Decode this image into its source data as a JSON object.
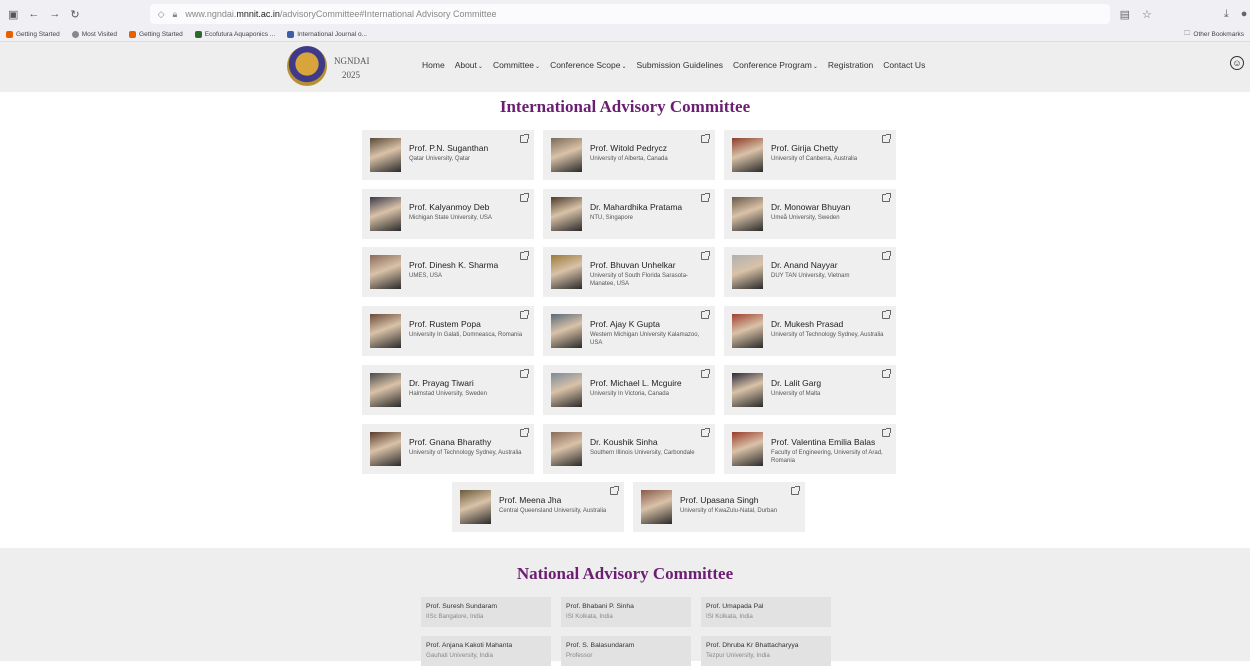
{
  "browser": {
    "url_prefix": "www.ngndai.",
    "url_domain": "mnnit.ac.in",
    "url_suffix": "/advisoryCommittee#International Advisory Committee",
    "bookmarks": [
      "Getting Started",
      "Most Visited",
      "Getting Started",
      "Ecofutura Aquaponics ...",
      "International Journal o..."
    ],
    "other_bookmarks": "Other Bookmarks"
  },
  "site": {
    "brand": "NGNDAI",
    "year": "2025",
    "menu": [
      "Home",
      "About",
      "Committee",
      "Conference Scope",
      "Submission Guidelines",
      "Conference Program",
      "Registration",
      "Contact Us"
    ]
  },
  "international": {
    "title": "International Advisory Committee",
    "members": [
      {
        "name": "Prof. P.N. Suganthan",
        "aff": "Qatar University, Qatar"
      },
      {
        "name": "Prof. Witold Pedrycz",
        "aff": "University of Alberta, Canada"
      },
      {
        "name": "Prof. Girija Chetty",
        "aff": "University of Canberra, Australia"
      },
      {
        "name": "Prof. Kalyanmoy Deb",
        "aff": "Michigan State University, USA"
      },
      {
        "name": "Dr. Mahardhika Pratama",
        "aff": "NTU, Singapore"
      },
      {
        "name": "Dr. Monowar Bhuyan",
        "aff": "Umeå University, Sweden"
      },
      {
        "name": "Prof. Dinesh K. Sharma",
        "aff": "UMES, USA"
      },
      {
        "name": "Prof. Bhuvan Unhelkar",
        "aff": "University of South Florida Sarasota-Manatee, USA"
      },
      {
        "name": "Dr. Anand Nayyar",
        "aff": "DUY TAN University, Vietnam"
      },
      {
        "name": "Prof. Rustem Popa",
        "aff": "University In Galati, Domneasca, Romania"
      },
      {
        "name": "Prof. Ajay K Gupta",
        "aff": "Western Michigan University Kalamazoo, USA"
      },
      {
        "name": "Dr. Mukesh Prasad",
        "aff": "University of Technology Sydney, Australia"
      },
      {
        "name": "Dr. Prayag Tiwari",
        "aff": "Halmstad University, Sweden"
      },
      {
        "name": "Prof. Michael L. Mcguire",
        "aff": "University In Victoria, Canada"
      },
      {
        "name": "Dr. Lalit Garg",
        "aff": "University of Malta"
      },
      {
        "name": "Prof. Gnana Bharathy",
        "aff": "University of Technology Sydney, Australia"
      },
      {
        "name": "Dr. Koushik Sinha",
        "aff": "Southern Illinois University, Carbondale"
      },
      {
        "name": "Prof. Valentina Emilia Balas",
        "aff": "Faculty of Engineering, University of Arad, Romania"
      },
      {
        "name": "Prof. Meena Jha",
        "aff": "Central Queensland University, Australia"
      },
      {
        "name": "Prof. Upasana Singh",
        "aff": "University of KwaZulu-Natal, Durban"
      }
    ]
  },
  "national": {
    "title": "National Advisory Committee",
    "members": [
      {
        "name": "Prof. Suresh Sundaram",
        "aff": "IISc Bangalore, India"
      },
      {
        "name": "Prof. Bhabani P. Sinha",
        "aff": "ISI Kolkata, India"
      },
      {
        "name": "Prof. Umapada Pal",
        "aff": "ISI Kolkata, India"
      },
      {
        "name": "Prof. Anjana Kakoti Mahanta",
        "aff": "Gauhati University, India"
      },
      {
        "name": "Prof. S. Balasundaram",
        "aff": "Professor"
      },
      {
        "name": "Prof. Dhruba Kr Bhattacharyya",
        "aff": "Tezpur University, India"
      }
    ]
  },
  "colors": {
    "accent": "#6b1e72",
    "card_bg": "#efefef"
  }
}
